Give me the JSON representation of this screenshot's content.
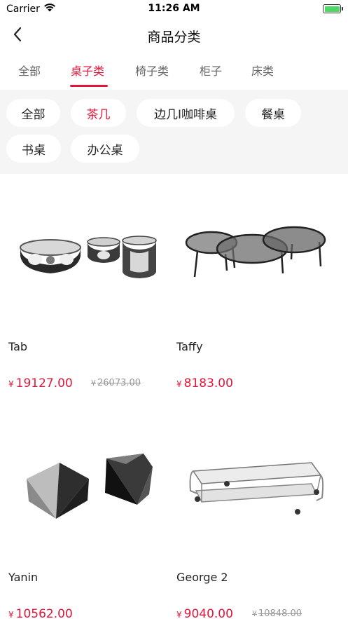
{
  "status": {
    "carrier": "Carrier",
    "time": "11:26 AM"
  },
  "nav": {
    "title": "商品分类"
  },
  "tabs": [
    {
      "label": "全部"
    },
    {
      "label": "桌子类"
    },
    {
      "label": "椅子类"
    },
    {
      "label": "柜子"
    },
    {
      "label": "床类"
    }
  ],
  "active_tab": "桌子类",
  "subcategories": [
    {
      "label": "全部"
    },
    {
      "label": "茶几"
    },
    {
      "label": "边几I咖啡桌"
    },
    {
      "label": "餐桌"
    },
    {
      "label": "书桌"
    },
    {
      "label": "办公桌"
    }
  ],
  "active_subcategory": "茶几",
  "products": [
    {
      "name": "Tab",
      "currency": "¥",
      "price": "19127.00",
      "original_price": "26073.00"
    },
    {
      "name": "Taffy",
      "currency": "¥",
      "price": "8183.00",
      "original_price": ""
    },
    {
      "name": "Yanin",
      "currency": "¥",
      "price": "10562.00",
      "original_price": ""
    },
    {
      "name": "George 2",
      "currency": "¥",
      "price": "9040.00",
      "original_price": "10848.00"
    }
  ],
  "colors": {
    "accent": "#e0173a",
    "panel": "#f5f5f5",
    "battery": "#4cd964"
  },
  "icons": {
    "signal": "wifi-icon",
    "battery": "battery-icon",
    "back": "chevron-left-icon"
  }
}
